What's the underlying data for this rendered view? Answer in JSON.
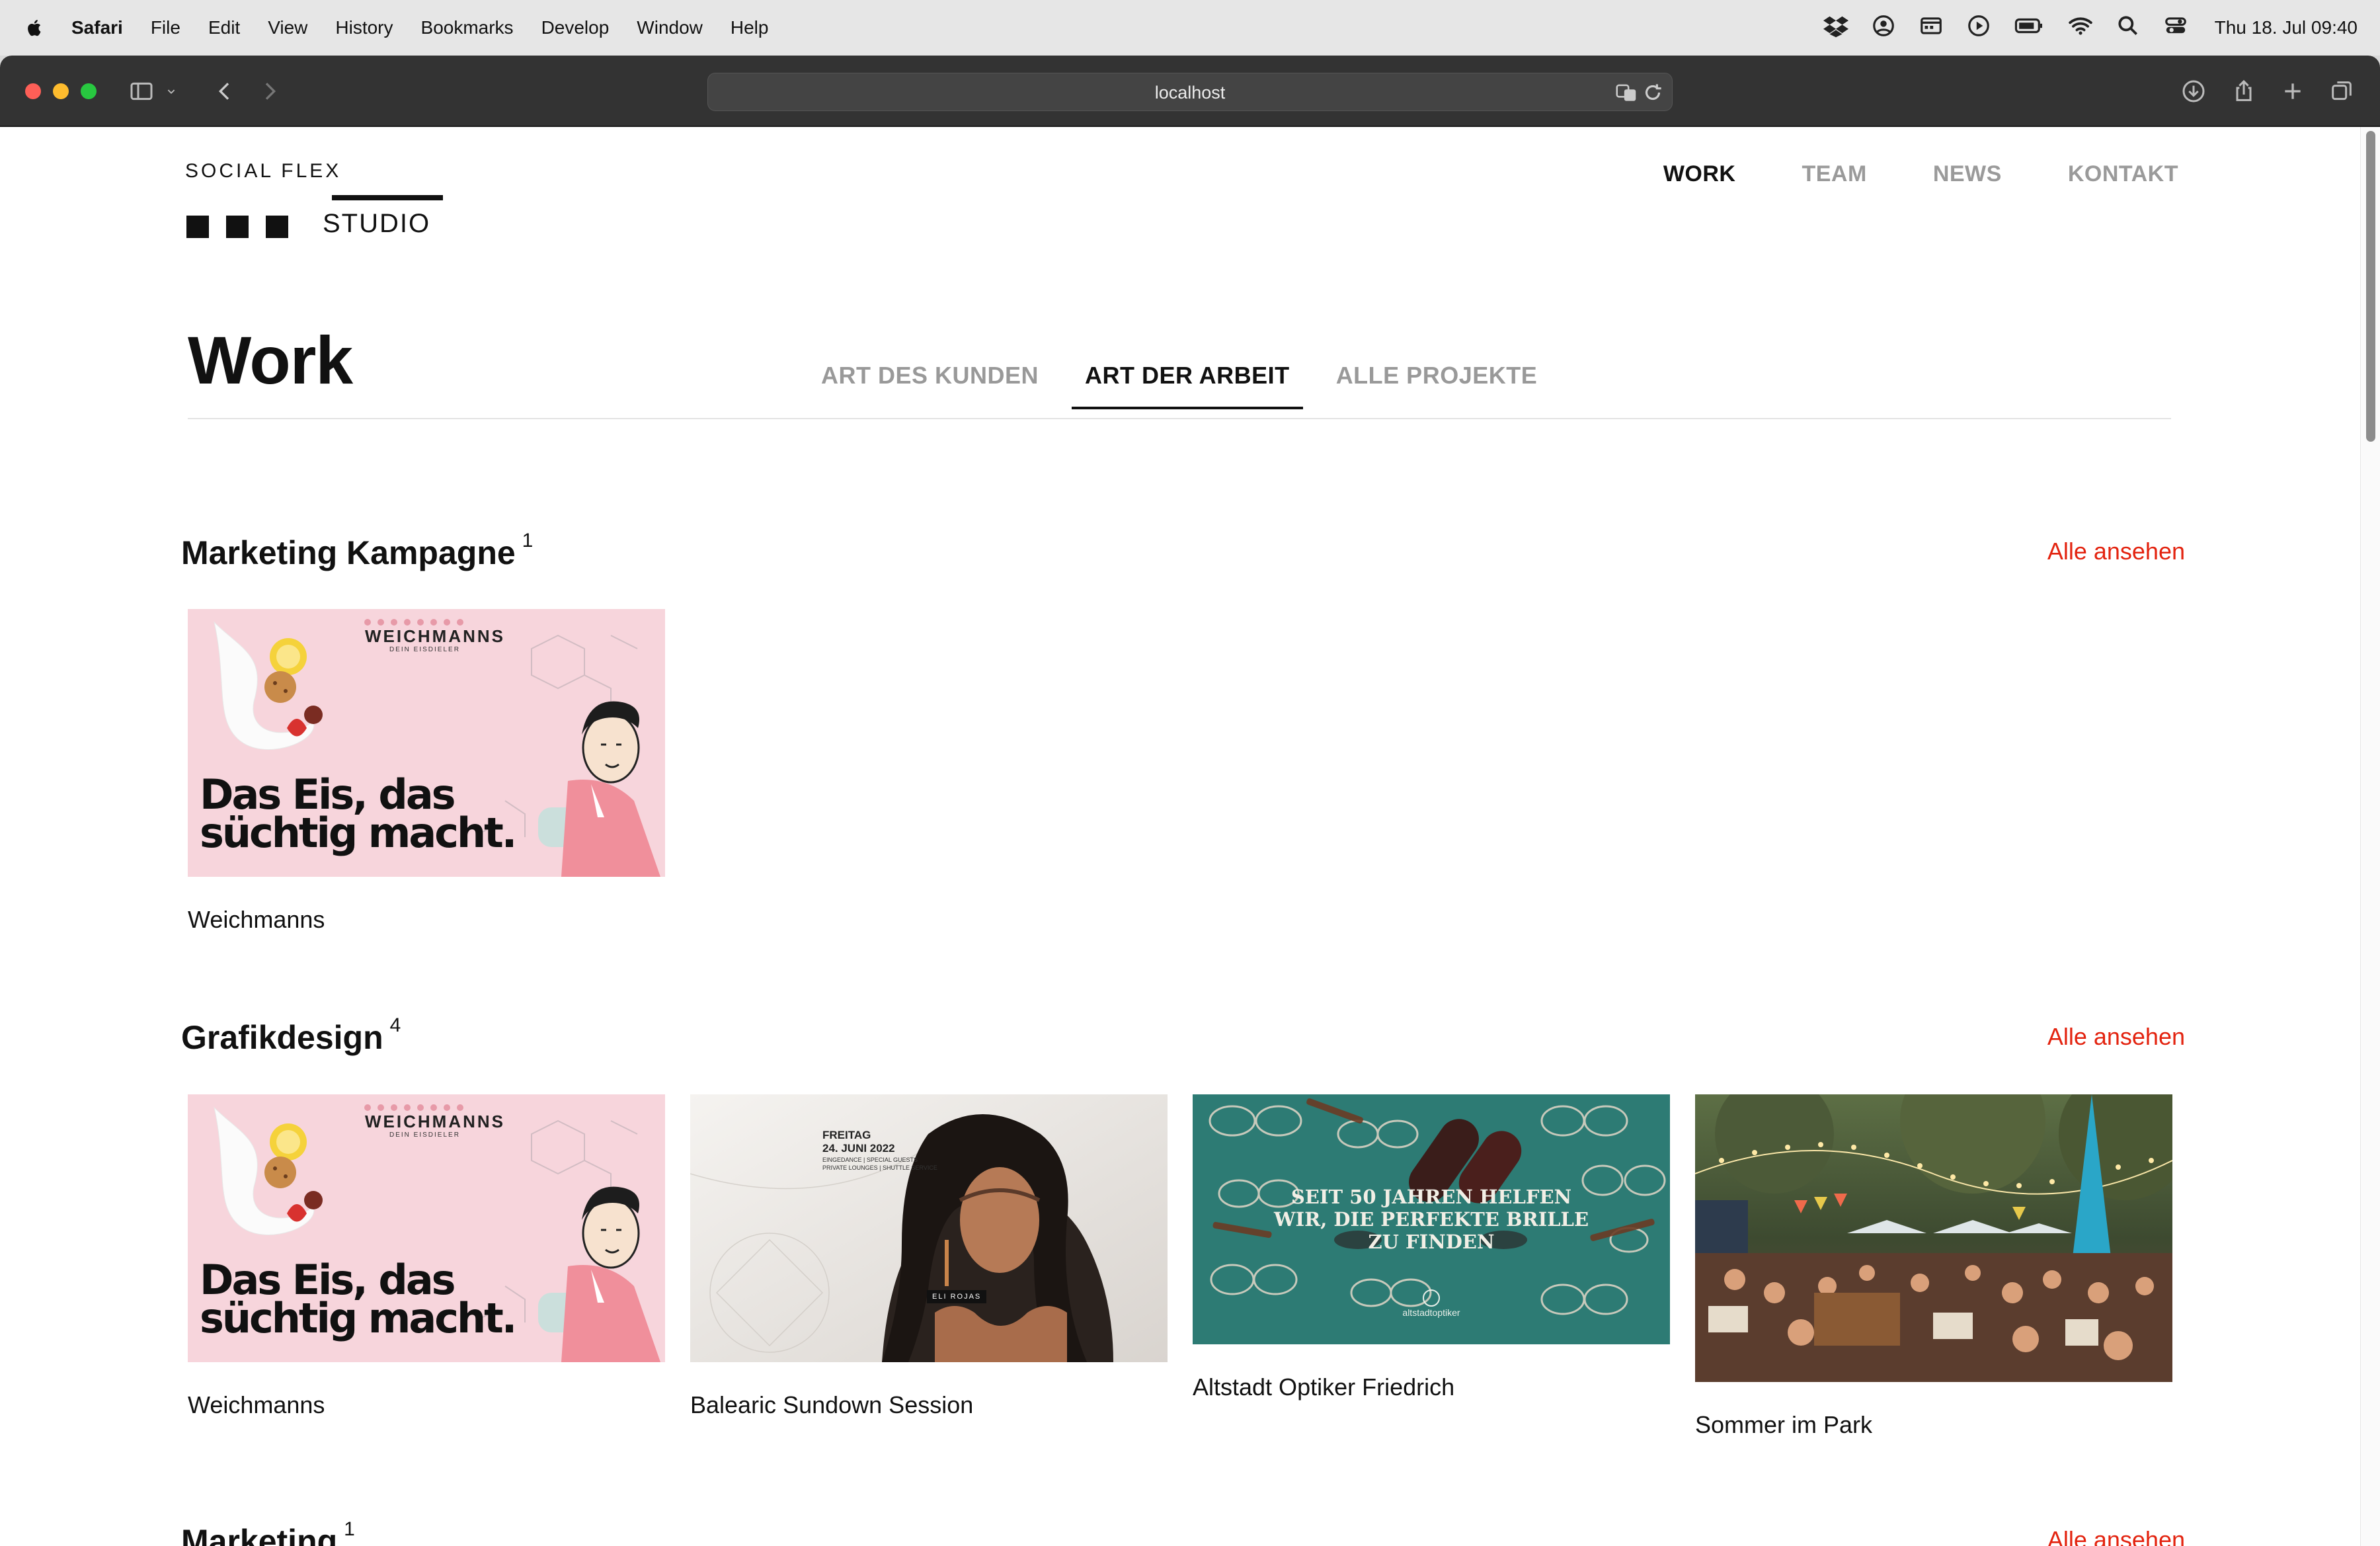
{
  "menubar": {
    "app": "Safari",
    "items": [
      "File",
      "Edit",
      "View",
      "History",
      "Bookmarks",
      "Develop",
      "Window",
      "Help"
    ],
    "clock": "Thu 18. Jul  09:40"
  },
  "browser": {
    "url": "localhost"
  },
  "site": {
    "logo_top": "SOCIAL FLEX",
    "logo_bottom": "STUDIO",
    "nav": [
      "WORK",
      "TEAM",
      "NEWS",
      "KONTAKT"
    ],
    "active_nav": "WORK"
  },
  "work": {
    "title": "Work",
    "tabs": [
      "ART DES KUNDEN",
      "ART DER ARBEIT",
      "ALLE PROJEKTE"
    ],
    "active_tab": "ART DER ARBEIT"
  },
  "sections": [
    {
      "title": "Marketing Kampagne",
      "count": "1",
      "see_all": "Alle ansehen",
      "projects": [
        {
          "name": "Weichmanns"
        }
      ]
    },
    {
      "title": "Grafikdesign",
      "count": "4",
      "see_all": "Alle ansehen",
      "projects": [
        {
          "name": "Weichmanns"
        },
        {
          "name": "Balearic Sundown Session"
        },
        {
          "name": "Altstadt Optiker Friedrich"
        },
        {
          "name": "Sommer im Park"
        }
      ]
    },
    {
      "title": "Marketing",
      "count": "1",
      "see_all": "Alle ansehen"
    }
  ],
  "thumbs": {
    "weichmanns": {
      "brand": "WEICHMANNS",
      "sub": "DEIN EISDIELER",
      "headline_1": "Das Eis, das",
      "headline_2": "süchtig macht."
    },
    "balearic": {
      "line1": "FREITAG",
      "line2": "24. JUNI 2022",
      "line3": "EINGEDANCE | SPECIAL GUESTS",
      "line4": "PRIVATE LOUNGES | SHUTTLE SERVICE",
      "tag": "ELI ROJAS"
    },
    "optiker": {
      "line1": "SEIT 50 JAHREN HELFEN",
      "line2": "WIR, DIE PERFEKTE BRILLE",
      "line3": "ZU FINDEN",
      "mark": "altstadtoptiker"
    }
  },
  "colors": {
    "accent": "#e3230f",
    "toolbar": "#333333",
    "weichmanns_bg": "#f7d5dc",
    "optiker_bg": "#2d7b74"
  }
}
